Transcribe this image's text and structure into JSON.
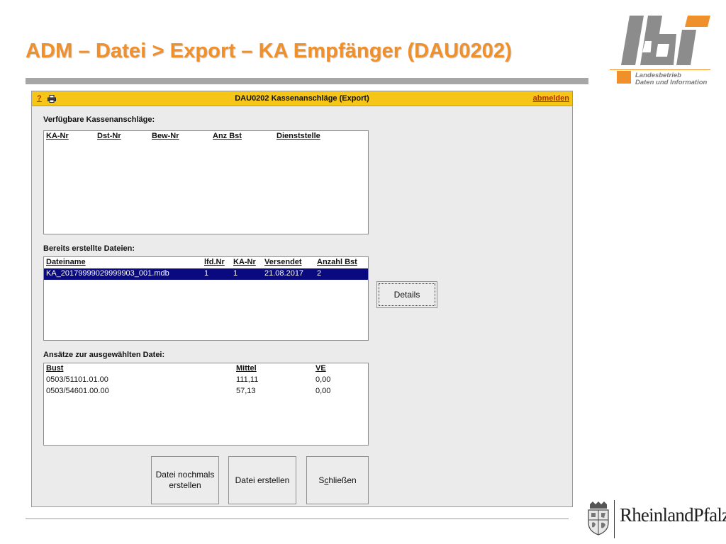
{
  "slide": {
    "title": "ADM – Datei > Export – KA Empfänger (DAU0202)",
    "accent_color": "#f0902a"
  },
  "ldi_logo": {
    "wordmark": "ldi",
    "caption_line1": "Landesbetrieb",
    "caption_line2": "Daten und Information"
  },
  "rlp_logo": {
    "text": "RheinlandPfalz",
    "crest_icon": "coat-of-arms-icon"
  },
  "window": {
    "help": "?",
    "print_icon": "printer-icon",
    "title": "DAU0202 Kassenanschläge (Export)",
    "logout": "abmelden",
    "titlebar_color": "#f5c518"
  },
  "available": {
    "label": "Verfügbare Kassenanschläge:",
    "columns": [
      "KA-Nr",
      "Dst-Nr",
      "Bew-Nr",
      "Anz Bst",
      "Dienststelle"
    ],
    "rows": []
  },
  "files": {
    "label": "Bereits erstellte Dateien:",
    "columns": [
      "Dateiname",
      "lfd.Nr",
      "KA-Nr",
      "Versendet",
      "Anzahl Bst"
    ],
    "rows": [
      [
        "KA_20179999029999903_001.mdb",
        "1",
        "1",
        "21.08.2017",
        "2"
      ]
    ],
    "selection_color": "#0a0a80"
  },
  "entries": {
    "label": "Ansätze zur ausgewählten Datei:",
    "columns": [
      "Bust",
      "Mittel",
      "VE"
    ],
    "rows": [
      [
        "0503/51101.01.00",
        "111,11",
        "0,00"
      ],
      [
        "0503/54601.00.00",
        "57,13",
        "0,00"
      ]
    ]
  },
  "buttons": {
    "details": "Details",
    "recreate_line1": "Datei nochmals",
    "recreate_line2": "erstellen",
    "create": "Datei erstellen",
    "close_pre": "S",
    "close_hotkey": "c",
    "close_post": "hließen"
  }
}
